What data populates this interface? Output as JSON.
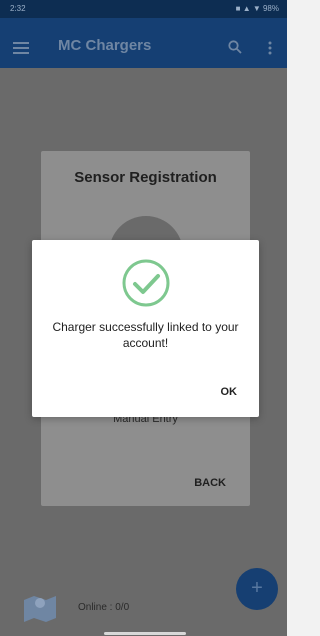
{
  "status_bar": {
    "time": "2:32",
    "icons": "■ ▲ ▼ 98%"
  },
  "app_bar": {
    "title": "MC Chargers",
    "menu_icon": "hamburger-icon",
    "search_icon": "search-icon",
    "more_icon": "more-vert-icon"
  },
  "registration_dialog": {
    "title": "Sensor Registration",
    "manual_entry": "Manual Entry",
    "back_label": "BACK"
  },
  "alert": {
    "icon": "check-circle-icon",
    "message": "Charger successfully linked to your account!",
    "ok_label": "OK",
    "accent": "#7ec88f"
  },
  "footer": {
    "online_text": "Online : 0/0",
    "fab_label": "+"
  },
  "colors": {
    "primary": "#153f73",
    "overlay": "#6a6a6a"
  }
}
